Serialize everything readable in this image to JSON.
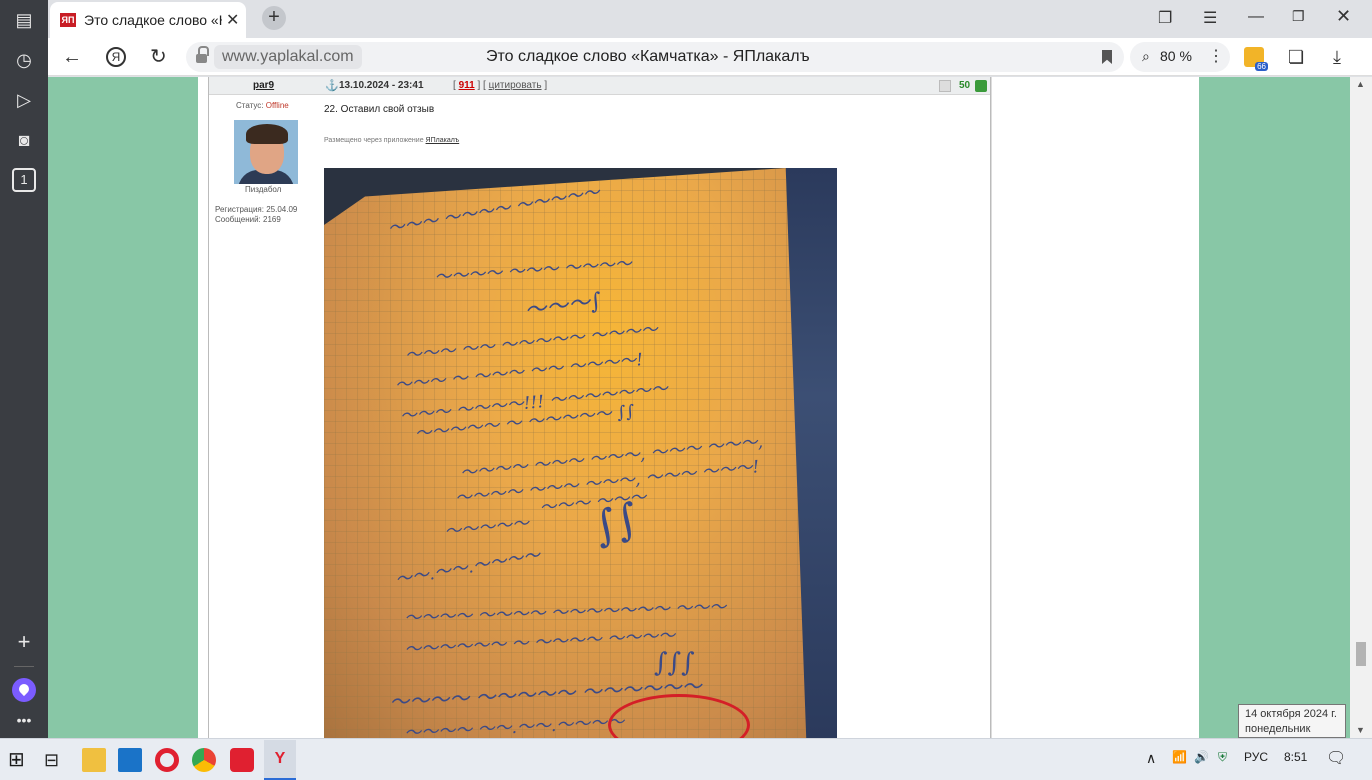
{
  "browser": {
    "tab_title": "Это сладкое слово «Кам",
    "url_domain": "www.yaplakal.com",
    "page_title": "Это сладкое слово «Камчатка» - ЯПлакалъ",
    "zoom": "80 %",
    "ext_badge": "66"
  },
  "post": {
    "username": "par9",
    "date": "13.10.2024 - 23:41",
    "post_number": "911",
    "quote_label": "цитировать",
    "rating": "50",
    "status_label": "Статус:",
    "status_value": "Offline",
    "rank": "Пиздабол",
    "registered": "Регистрация: 25.04.09",
    "messages": "Сообщений: 2169",
    "message_text": "22. Оставил свой отзыв",
    "via_text": "Размещено через приложение",
    "app_name": "ЯПлакалъ"
  },
  "tooltip": {
    "line1": "14 октября 2024 г.",
    "line2": "понедельник"
  },
  "taskbar": {
    "lang": "РУС",
    "time": "8:51"
  },
  "colors": {
    "page_bg": "#88c7a6",
    "circle": "#d41f27",
    "status_offline": "#c0392b"
  }
}
